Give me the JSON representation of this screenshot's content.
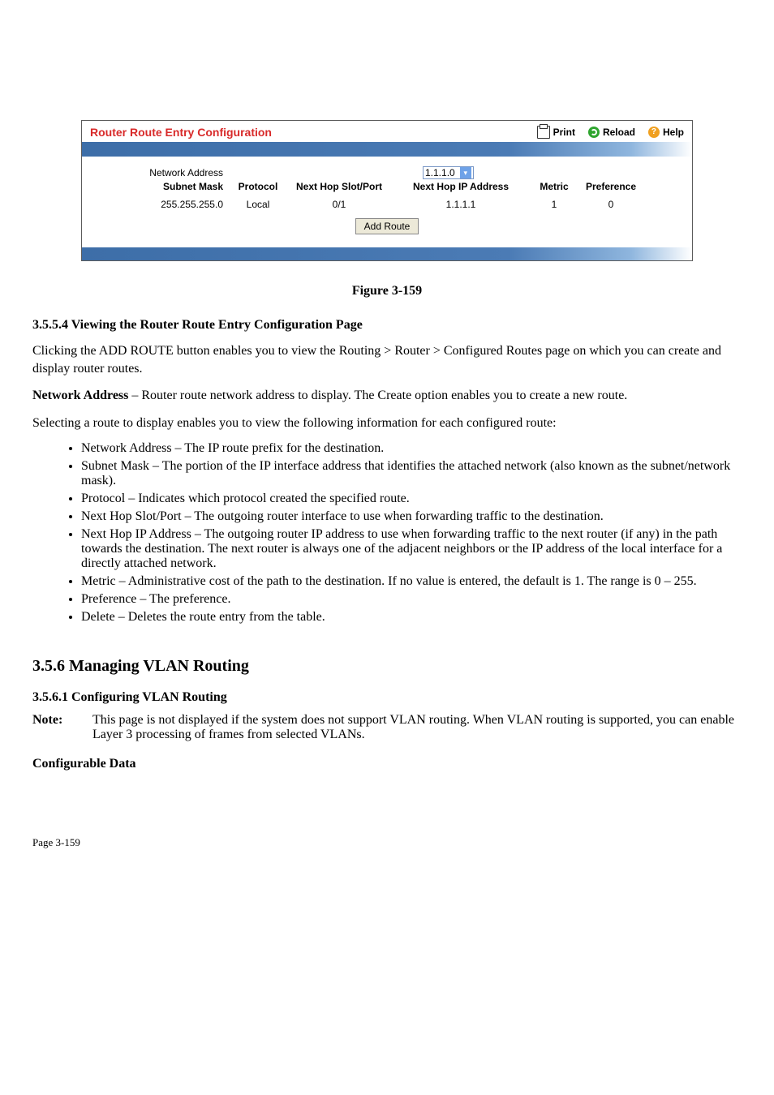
{
  "panel": {
    "title": "Router Route Entry Configuration",
    "actions": {
      "print": "Print",
      "reload": "Reload",
      "help": "Help"
    }
  },
  "table": {
    "network_address_label": "Network Address",
    "network_address_value": "1.1.1.0",
    "headers": {
      "subnet_mask": "Subnet Mask",
      "protocol": "Protocol",
      "next_hop": "Next Hop  Slot/Port",
      "next_ip": "Next Hop IP Address",
      "metric": "Metric",
      "preference": "Preference"
    },
    "row": {
      "subnet_mask": "255.255.255.0",
      "protocol": "Local",
      "next_hop": "0/1",
      "next_ip": "1.1.1.1",
      "metric": "1",
      "preference": "0"
    },
    "add_route_btn": "Add Route"
  },
  "doc": {
    "fig_caption": "Figure 3-159",
    "section_title": "3.5.5.4 Viewing the Router Route Entry Configuration Page",
    "intro": "Clicking the ADD ROUTE button enables you to view the Routing > Router > Configured Routes page on which you can create and display router routes.",
    "netaddr_line_prefix": "Network Address",
    "netaddr_line_rest": " – Router route network address to display. The Create option enables you to create a new route.",
    "select_intro": "Selecting a route to display enables you to view the following information for each configured route:",
    "bullets": [
      "Network Address – The IP route prefix for the destination.",
      "Subnet Mask – The portion of the IP interface address that identifies the attached network (also known as the subnet/network mask).",
      "Protocol – Indicates which protocol created the specified route.",
      "Next Hop Slot/Port – The outgoing router interface to use when forwarding traffic to the destination.",
      "Next Hop IP Address – The outgoing router IP address to use when forwarding traffic to the next router (if any) in the path towards the destination. The next router is always one of the adjacent neighbors or the IP address of the local interface for a directly attached network.",
      "Metric – Administrative cost of the path to the destination. If no value is entered, the default is 1. The range is 0 – 255.",
      "Preference – The preference.",
      "Delete – Deletes the route entry from the table."
    ],
    "h2": "3.5.6 Managing VLAN Routing",
    "subh": "3.5.6.1 Configuring VLAN Routing",
    "note_label": "Note:",
    "note_body": "This page is not displayed if the system does not support VLAN routing. When VLAN routing is supported, you can enable Layer 3 processing of frames from selected VLANs.",
    "subh2": "Configurable Data",
    "footer_left": "Page 3-159",
    "footer_right": ""
  }
}
